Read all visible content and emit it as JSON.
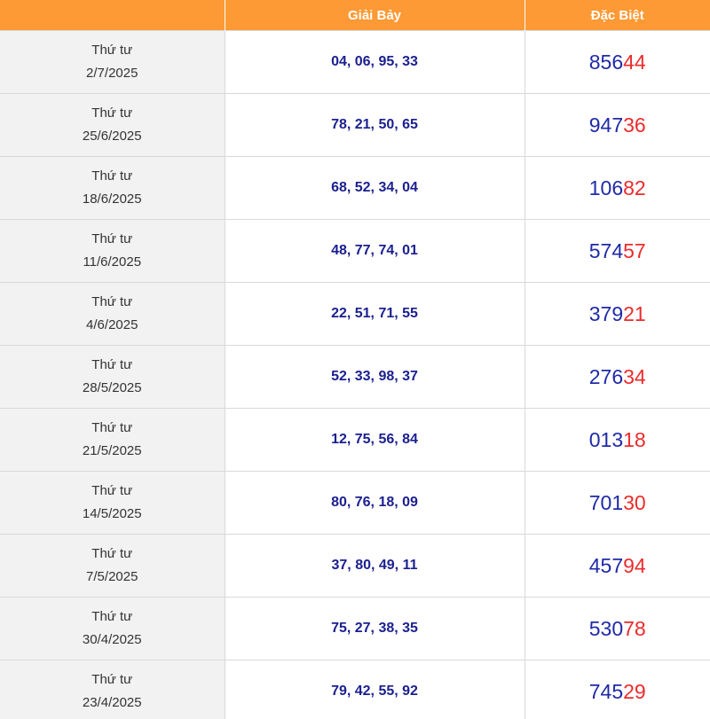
{
  "columns": {
    "date": "",
    "giai_bay": "Giải Bảy",
    "dac_biet": "Đặc Biệt"
  },
  "colors": {
    "header_bg": "#fd9a35",
    "date_bg": "#f2f2f2",
    "number_blue": "#1a1f8f",
    "tail_red": "#ec2b2b"
  },
  "rows": [
    {
      "weekday": "Thứ tư",
      "date": "2/7/2025",
      "giai_bay": "04, 06, 95, 33",
      "db_head": "856",
      "db_tail": "44"
    },
    {
      "weekday": "Thứ tư",
      "date": "25/6/2025",
      "giai_bay": "78, 21, 50, 65",
      "db_head": "947",
      "db_tail": "36"
    },
    {
      "weekday": "Thứ tư",
      "date": "18/6/2025",
      "giai_bay": "68, 52, 34, 04",
      "db_head": "106",
      "db_tail": "82"
    },
    {
      "weekday": "Thứ tư",
      "date": "11/6/2025",
      "giai_bay": "48, 77, 74, 01",
      "db_head": "574",
      "db_tail": "57"
    },
    {
      "weekday": "Thứ tư",
      "date": "4/6/2025",
      "giai_bay": "22, 51, 71, 55",
      "db_head": "379",
      "db_tail": "21"
    },
    {
      "weekday": "Thứ tư",
      "date": "28/5/2025",
      "giai_bay": "52, 33, 98, 37",
      "db_head": "276",
      "db_tail": "34"
    },
    {
      "weekday": "Thứ tư",
      "date": "21/5/2025",
      "giai_bay": "12, 75, 56, 84",
      "db_head": "013",
      "db_tail": "18"
    },
    {
      "weekday": "Thứ tư",
      "date": "14/5/2025",
      "giai_bay": "80, 76, 18, 09",
      "db_head": "701",
      "db_tail": "30"
    },
    {
      "weekday": "Thứ tư",
      "date": "7/5/2025",
      "giai_bay": "37, 80, 49, 11",
      "db_head": "457",
      "db_tail": "94"
    },
    {
      "weekday": "Thứ tư",
      "date": "30/4/2025",
      "giai_bay": "75, 27, 38, 35",
      "db_head": "530",
      "db_tail": "78"
    },
    {
      "weekday": "Thứ tư",
      "date": "23/4/2025",
      "giai_bay": "79, 42, 55, 92",
      "db_head": "745",
      "db_tail": "29"
    }
  ]
}
